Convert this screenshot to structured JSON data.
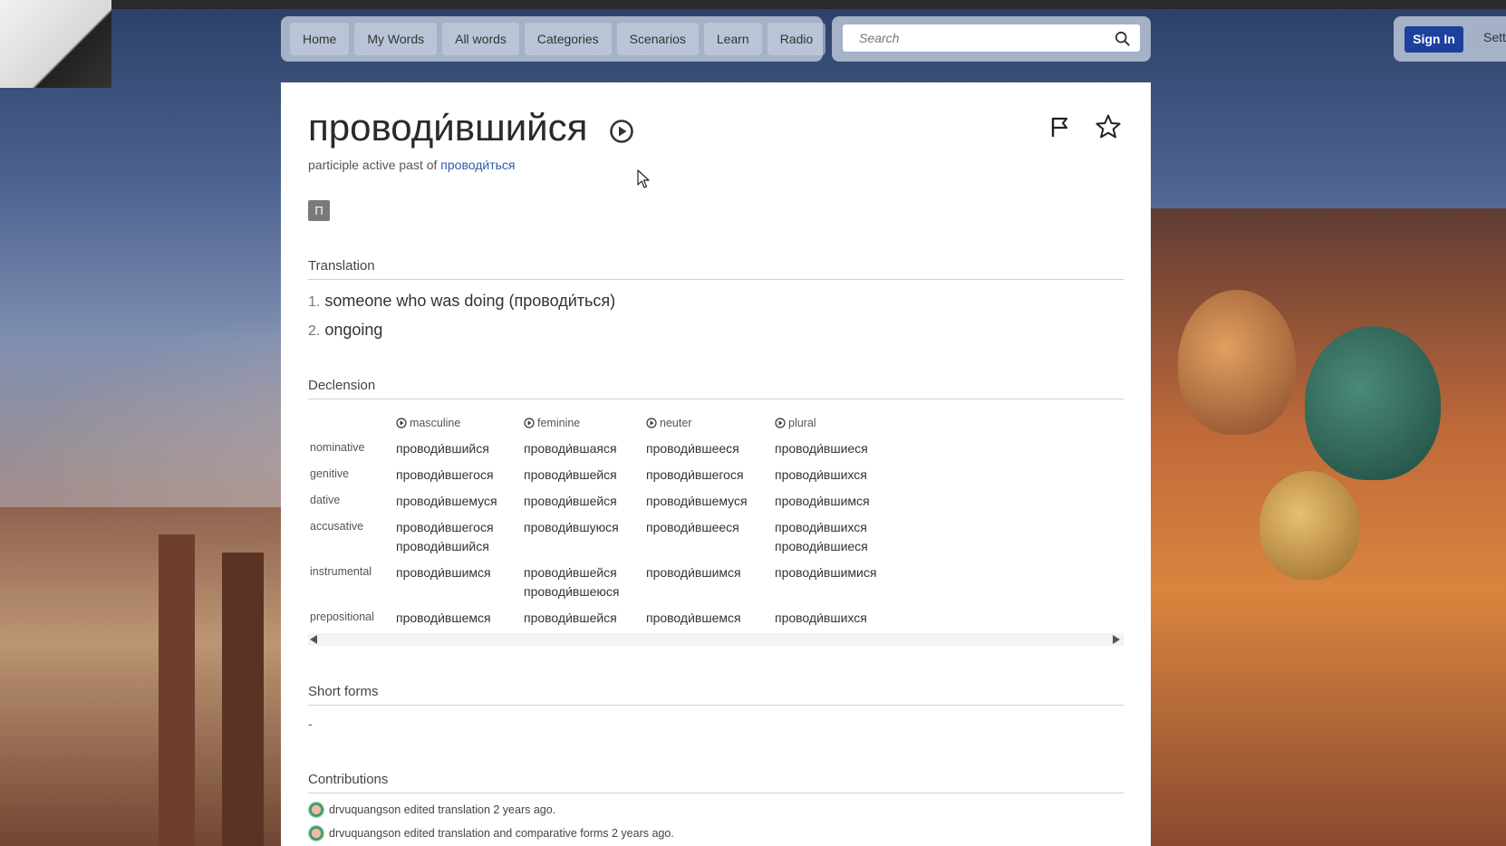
{
  "nav": {
    "items": [
      "Home",
      "My Words",
      "All words",
      "Categories",
      "Scenarios",
      "Learn",
      "Radio"
    ]
  },
  "search": {
    "placeholder": "Search"
  },
  "header": {
    "sign_in": "Sign In",
    "settings": "Sett"
  },
  "word": {
    "title": "проводи́вшийся",
    "subtitle_prefix": "participle active past of",
    "subtitle_link": "проводи́ться",
    "badge": "П"
  },
  "translation": {
    "heading": "Translation",
    "items": [
      {
        "num": "1.",
        "text": "someone who was doing (проводи́ться)"
      },
      {
        "num": "2.",
        "text": "ongoing"
      }
    ]
  },
  "declension": {
    "heading": "Declension",
    "columns": [
      "masculine",
      "feminine",
      "neuter",
      "plural"
    ],
    "rows": [
      {
        "case": "nominative",
        "cells": [
          [
            "проводи́вшийся"
          ],
          [
            "проводи́вшаяся"
          ],
          [
            "проводи́вшееся"
          ],
          [
            "проводи́вшиеся"
          ]
        ]
      },
      {
        "case": "genitive",
        "cells": [
          [
            "проводи́вшегося"
          ],
          [
            "проводи́вшейся"
          ],
          [
            "проводи́вшегося"
          ],
          [
            "проводи́вшихся"
          ]
        ]
      },
      {
        "case": "dative",
        "cells": [
          [
            "проводи́вшемуся"
          ],
          [
            "проводи́вшейся"
          ],
          [
            "проводи́вшемуся"
          ],
          [
            "проводи́вшимся"
          ]
        ]
      },
      {
        "case": "accusative",
        "cells": [
          [
            "проводи́вшегося",
            "проводи́вшийся"
          ],
          [
            "проводи́вшуюся"
          ],
          [
            "проводи́вшееся"
          ],
          [
            "проводи́вшихся",
            "проводи́вшиеся"
          ]
        ]
      },
      {
        "case": "instrumental",
        "cells": [
          [
            "проводи́вшимся"
          ],
          [
            "проводи́вшейся",
            "проводи́вшеюся"
          ],
          [
            "проводи́вшимся"
          ],
          [
            "проводи́вшимися"
          ]
        ]
      },
      {
        "case": "prepositional",
        "cells": [
          [
            "проводи́вшемся"
          ],
          [
            "проводи́вшейся"
          ],
          [
            "проводи́вшемся"
          ],
          [
            "проводи́вшихся"
          ]
        ]
      }
    ]
  },
  "short_forms": {
    "heading": "Short forms",
    "value": "-"
  },
  "contributions": {
    "heading": "Contributions",
    "items": [
      "drvuquangson edited translation 2 years ago.",
      "drvuquangson edited translation and comparative forms 2 years ago."
    ]
  }
}
